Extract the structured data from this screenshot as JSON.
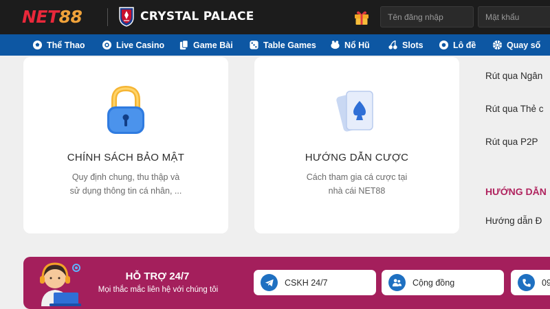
{
  "header": {
    "brand_part1": "NET",
    "brand_part2": "88",
    "club_name": "CRYSTAL PALACE",
    "username_placeholder": "Tên đăng nhập",
    "password_placeholder": "Mật khẩu",
    "gift_icon": "gift-icon"
  },
  "nav": {
    "items": [
      {
        "label": "Thể Thao",
        "icon": "soccer-ball-icon"
      },
      {
        "label": "Live Casino",
        "icon": "casino-chip-icon"
      },
      {
        "label": "Game Bài",
        "icon": "cards-icon"
      },
      {
        "label": "Table Games",
        "icon": "dice-icon"
      },
      {
        "label": "Nổ Hũ",
        "icon": "piggy-icon"
      },
      {
        "label": "Slots",
        "icon": "cherries-icon"
      },
      {
        "label": "Lô đề",
        "icon": "lottery-ball-icon"
      },
      {
        "label": "Quay số",
        "icon": "wheel-icon"
      }
    ]
  },
  "cards": [
    {
      "title": "CHÍNH SÁCH BẢO MẬT",
      "desc_line1": "Quy định chung, thu thập và",
      "desc_line2": "sử dụng thông tin cá nhân, ...",
      "icon": "padlock-icon"
    },
    {
      "title": "HƯỚNG DẪN CƯỢC",
      "desc_line1": "Cách tham gia cá cược tại",
      "desc_line2": "nhà cái NET88",
      "icon": "playing-cards-icon"
    }
  ],
  "right_column": {
    "links": [
      "Rút qua Ngân",
      "Rút qua Thẻ c",
      "Rút qua P2P"
    ],
    "heading": "HƯỚNG DẪN",
    "link_after": "Hướng dẫn Đ"
  },
  "support": {
    "title": "HỖ TRỢ 24/7",
    "subtitle": "Mọi thắc mắc liên hệ với chúng tôi",
    "contacts": [
      {
        "label": "CSKH 24/7",
        "icon": "telegram-icon"
      },
      {
        "label": "Cộng đồng",
        "icon": "community-icon"
      },
      {
        "label": "09",
        "icon": "phone-icon"
      }
    ]
  },
  "colors": {
    "header_bg": "#1c1c1c",
    "nav_bg": "#0d57a3",
    "brand_red": "#e9283a",
    "brand_orange": "#f0a23a",
    "support_bg": "#a41f5c",
    "heading_accent": "#b0245f"
  }
}
